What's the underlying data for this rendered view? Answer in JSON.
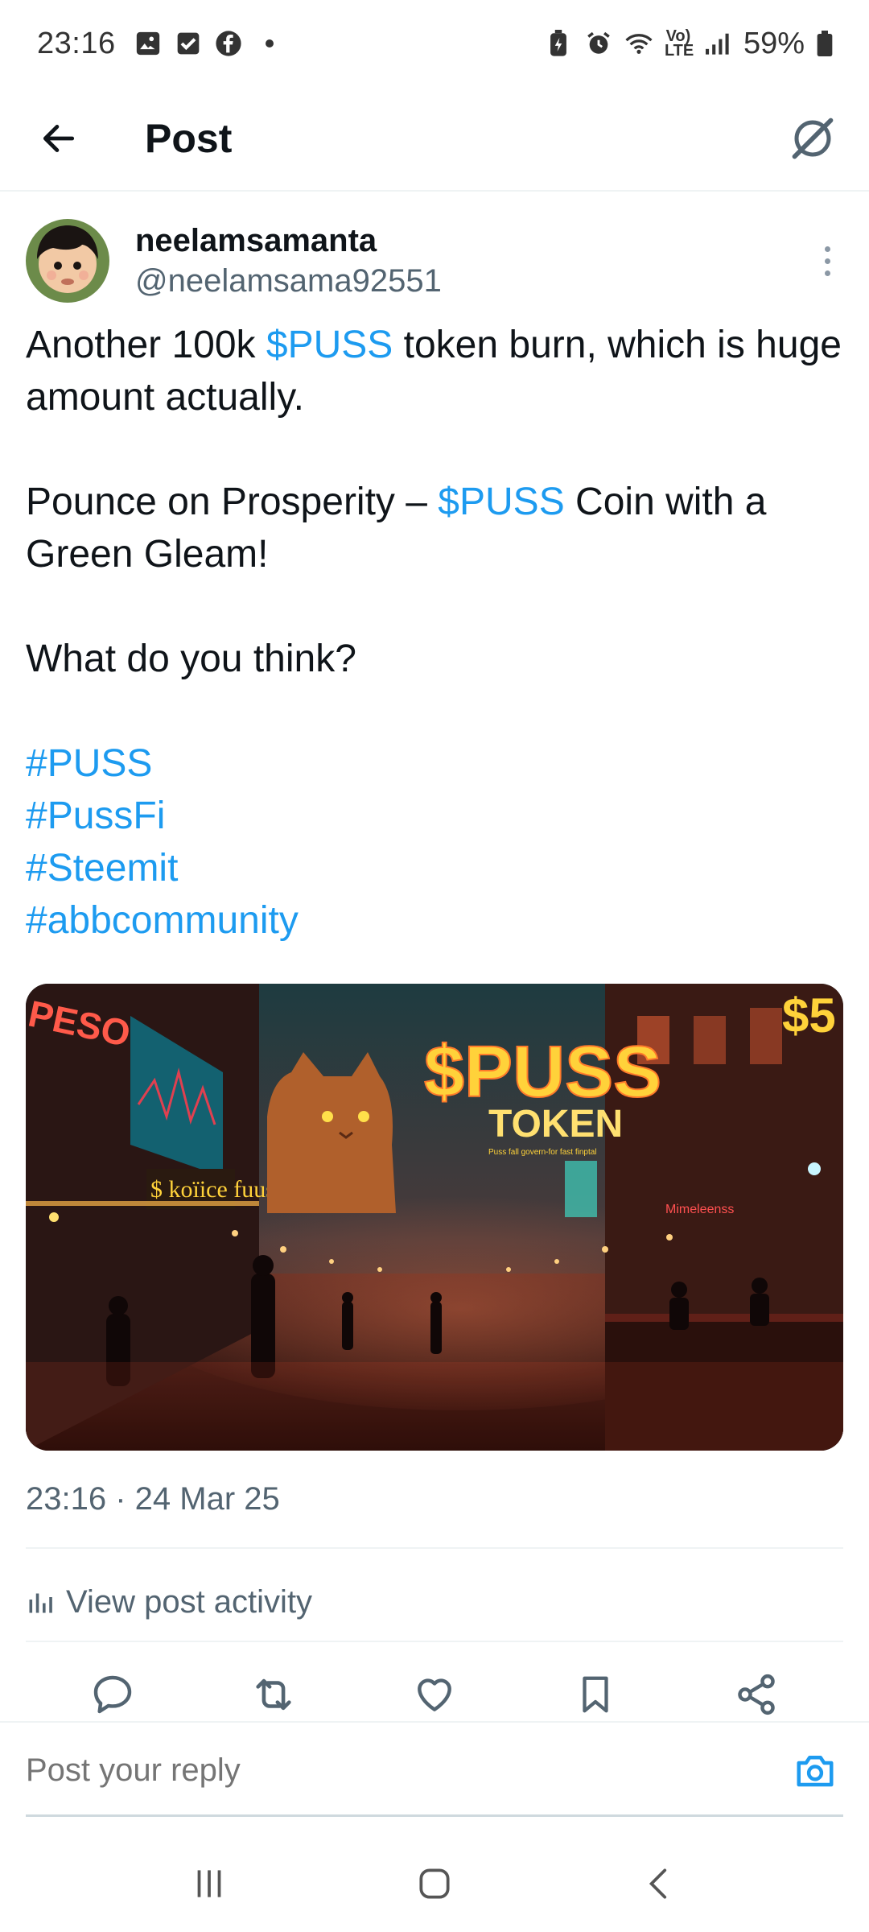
{
  "status_bar": {
    "time": "23:16",
    "battery": "59%",
    "left_icons": [
      "gallery-icon",
      "checkbox-icon",
      "facebook-icon"
    ],
    "right_icons": [
      "battery-saver-icon",
      "alarm-icon",
      "wifi-icon",
      "volte-icon",
      "signal-icon",
      "battery-icon"
    ],
    "network_label": "Vo) LTE"
  },
  "header": {
    "title": "Post",
    "back_icon": "arrow-left-icon",
    "grok_icon": "grok-icon"
  },
  "post": {
    "author_name": "neelamsamanta",
    "author_handle": "@neelamsama92551",
    "line1_pre": "Another 100k ",
    "line1_cashtag": "$PUSS",
    "line1_post": " token burn, which is huge amount actually.",
    "line2_pre": "Pounce on Prosperity – ",
    "line2_cashtag": "$PUSS",
    "line2_post": " Coin with a Green Gleam!",
    "line3": "What do you think?",
    "hashtags": [
      "#PUSS",
      "#PussFi",
      "#Steemit",
      "#abbcommunity"
    ],
    "image_text": {
      "sign_main": "$PUSS",
      "sign_sub": "TOKEN",
      "sign_tagline": "Puss fall govern-for fast finptal",
      "shop_sign": "$ koïice fuus",
      "left_sign": "PESO",
      "corner_sign": "$5",
      "side_sign": "Mimeleenss"
    },
    "timestamp": "23:16 · 24 Mar 25",
    "activity_label": "View post activity"
  },
  "actions": [
    "reply-icon",
    "repost-icon",
    "like-icon",
    "bookmark-icon",
    "share-icon"
  ],
  "reply": {
    "placeholder": "Post your reply"
  },
  "colors": {
    "link": "#1d9bf0",
    "text": "#0f1419",
    "secondary": "#536471"
  }
}
